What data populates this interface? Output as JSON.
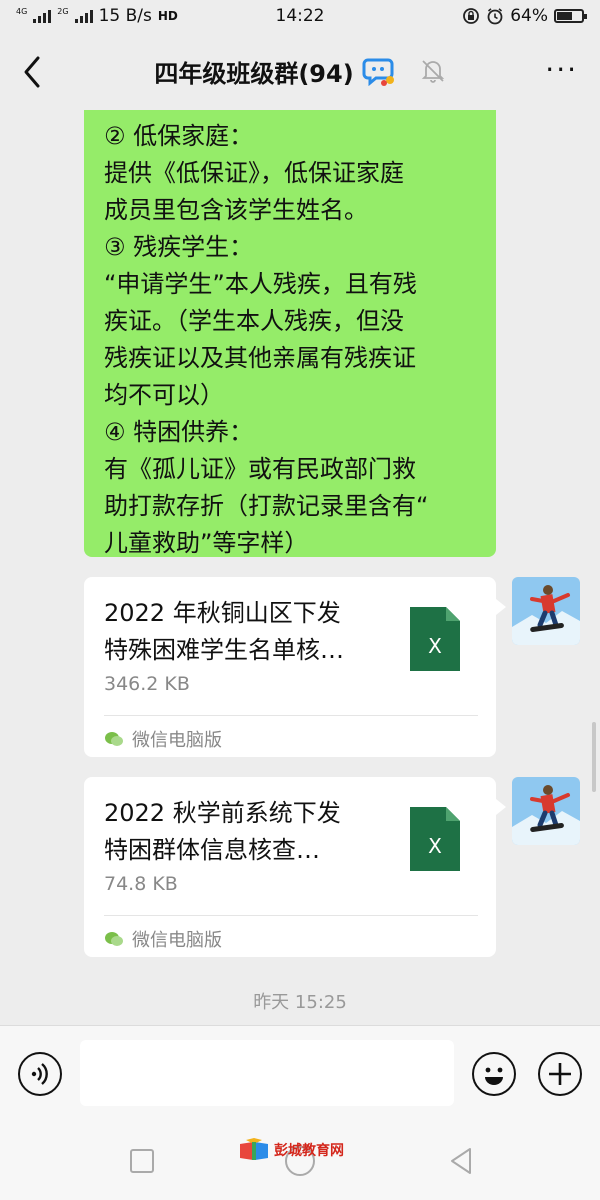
{
  "status_bar": {
    "net_tag_1": "4G",
    "net_tag_2": "2G",
    "speed": "15 B/s",
    "hd_label": "HD",
    "time": "14:22",
    "battery": "64%",
    "battery_level": 0.64
  },
  "header": {
    "title": "四年级班级群(94)",
    "back_icon": "chevron-left-icon",
    "more_label": "···",
    "mute_icon": "bell-off-icon",
    "assistant_icon": "chat-assistant-icon"
  },
  "messages": {
    "green_bubble": {
      "lines": [
        "② 低保家庭：",
        "提供《低保证》，低保证家庭",
        "成员里包含该学生姓名。",
        "③ 残疾学生：",
        "“申请学生”本人残疾，且有残",
        "疾证。（学生本人残疾，但没",
        "残疾证以及其他亲属有残疾证",
        "均不可以）",
        "④ 特困供养：",
        "有《孤儿证》或有民政部门救",
        "助打款存折（打款记录里含有“",
        "儿童救助”等字样）"
      ]
    },
    "files": [
      {
        "name_line1": "2022 年秋铜山区下发",
        "name_line2": "特殊困难学生名单核…",
        "size": "346.2 KB",
        "source": "微信电脑版",
        "icon_label": "X"
      },
      {
        "name_line1": "2022 秋学前系统下发",
        "name_line2": "特困群体信息核查…",
        "size": "74.8 KB",
        "source": "微信电脑版",
        "icon_label": "X"
      }
    ],
    "timestamp": "昨天 15:25"
  },
  "input_bar": {
    "value": "",
    "placeholder": ""
  },
  "watermark": {
    "text": "彭城教育网"
  },
  "colors": {
    "bubble_green": "#95ec69",
    "excel_green": "#1e7145",
    "background": "#ededed"
  }
}
